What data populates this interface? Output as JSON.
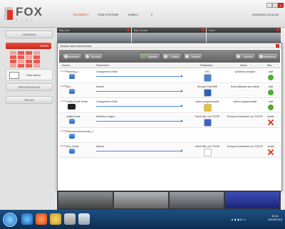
{
  "app": {
    "logo_text": "FOX",
    "logo_sub": "V I S I",
    "tabs": [
      {
        "label": "EN DIRECT",
        "active": true
      },
      {
        "label": "CRM SYSTEME",
        "active": false
      },
      {
        "label": "DWBL3",
        "active": false
      },
      {
        "label": "2",
        "active": false
      }
    ],
    "datetime": "29/06/2015 15:41:58"
  },
  "sidebar": {
    "sections": [
      "CAMERAS",
      "PRESENTATION",
      "RELAIS"
    ],
    "video_label": "VIDEO",
    "plan_label": "Plan action"
  },
  "cameras": [
    {
      "label": "Bat_Est"
    },
    {
      "label": "Bat_Ouest"
    },
    {
      "label": "Nord"
    }
  ],
  "dialog": {
    "title": "Gestion des évènements",
    "toolbar": {
      "btn_precedent": "Précédent",
      "btn_suivant": "Suivant",
      "btn_ajouter": "Ajouter",
      "btn_editer": "Éditer",
      "btn_retirer": "Retirer",
      "btn_activer": "Activer",
      "btn_desactiver": "Désactiver"
    },
    "columns": [
      "Source",
      "Évènement",
      "Destination",
      "Action",
      "État"
    ],
    "rows": [
      {
        "time": "21:00",
        "source": "Planning_1",
        "event": "Changement d'état",
        "destination": "EH1",
        "action": "Activation Analyse",
        "state": "actif",
        "on": true
      },
      {
        "time": "14:08",
        "source": "Es1",
        "event": "Alarme",
        "destination": "Envoyer Fax/SMS",
        "action": "Envoi distance aux clients",
        "state": "actif",
        "on": true
      },
      {
        "time": "12:12",
        "source": "Quitter/Sortir Sortie",
        "event": "Changement d'état",
        "destination": "action programmable",
        "action": "action programmable",
        "state": "actif",
        "on": true
      },
      {
        "time": "",
        "source": "Quitter/Sortir",
        "event": "Détection unique",
        "destination": "Client SNL sur TOCSF",
        "action": "Envoyer évènement sur TOCSF",
        "state": "arrêté",
        "on": false
      },
      {
        "time": "07:00",
        "source": "Planning chevauchant_2",
        "event": "",
        "destination": "",
        "action": "",
        "state": "",
        "on": null
      },
      {
        "time": "20:10",
        "source": "Sud_Ouest",
        "event": "Alarme",
        "destination": "Client SNL sur TOCSF",
        "action": "Envoyer évènement sur TOCSF",
        "state": "arrêté",
        "on": false
      }
    ]
  },
  "taskbar": {
    "clock_time": "15:41",
    "clock_date": "29/06/2015"
  },
  "colors": {
    "accent": "#d2231a",
    "toolbar": "#6f6f6f",
    "taskbar": "#1d4f80"
  }
}
